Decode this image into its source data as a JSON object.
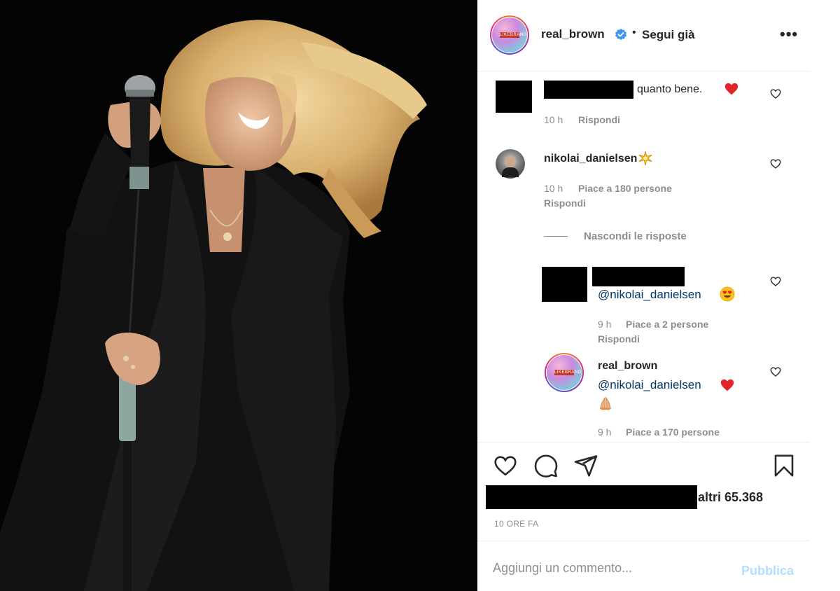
{
  "header": {
    "username": "real_brown",
    "dot": "•",
    "follow_label": "Segui già",
    "more_label": "•••"
  },
  "avatar_badge": "LIKEBRAND",
  "comments": [
    {
      "text": "quanto bene.",
      "time": "10 h",
      "reply": "Rispondi"
    },
    {
      "username": "nikolai_danielsen",
      "time": "10 h",
      "likes": "Piace a 180 persone",
      "reply": "Rispondi"
    }
  ],
  "hide_replies": "Nascondi le risposte",
  "replies": [
    {
      "mention": "@nikolai_danielsen",
      "time": "9 h",
      "likes": "Piace a 2 persone",
      "reply": "Rispondi"
    },
    {
      "username": "real_brown",
      "mention": "@nikolai_danielsen",
      "time": "9 h",
      "likes": "Piace a 170 persone"
    }
  ],
  "likes_suffix": "altri 65.368",
  "time_ago": "10 ORE FA",
  "add_comment": {
    "placeholder": "Aggiungi un commento...",
    "publish": "Pubblica"
  },
  "icons": {
    "like": "heart-icon",
    "comment": "comment-icon",
    "share": "paper-plane-icon",
    "save": "bookmark-icon",
    "verified": "verified-badge-icon",
    "comment_like": "small-heart-icon"
  },
  "colors": {
    "verified": "#3897f0",
    "mention": "#00376b",
    "publish_disabled": "#b2dffc",
    "heart_red": "#ed4956"
  }
}
